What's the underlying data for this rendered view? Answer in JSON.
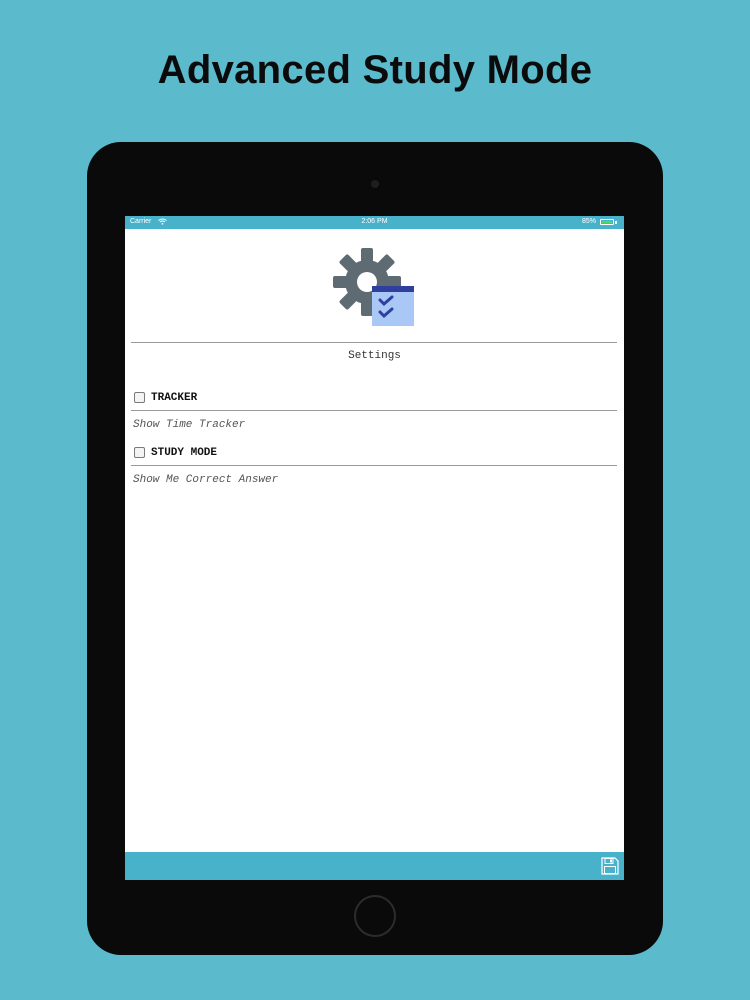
{
  "headline": "Advanced Study Mode",
  "statusbar": {
    "carrier": "Carrier",
    "time": "2:06 PM",
    "battery": "85%"
  },
  "settings": {
    "title": "Settings",
    "options": [
      {
        "label": "TRACKER",
        "description": "Show Time Tracker",
        "checked": false
      },
      {
        "label": "STUDY MODE",
        "description": "Show Me Correct Answer",
        "checked": false
      }
    ]
  },
  "colors": {
    "background": "#5cbacd",
    "accent_bar": "#48b2cb",
    "logo_gear": "#5f6b73",
    "logo_calendar": "#aac8f5",
    "logo_calendar_header": "#2f3f9e"
  },
  "icons": {
    "logo": "gear-calendar-icon",
    "save": "floppy-disk-icon",
    "wifi": "wifi-icon",
    "battery": "battery-icon"
  }
}
